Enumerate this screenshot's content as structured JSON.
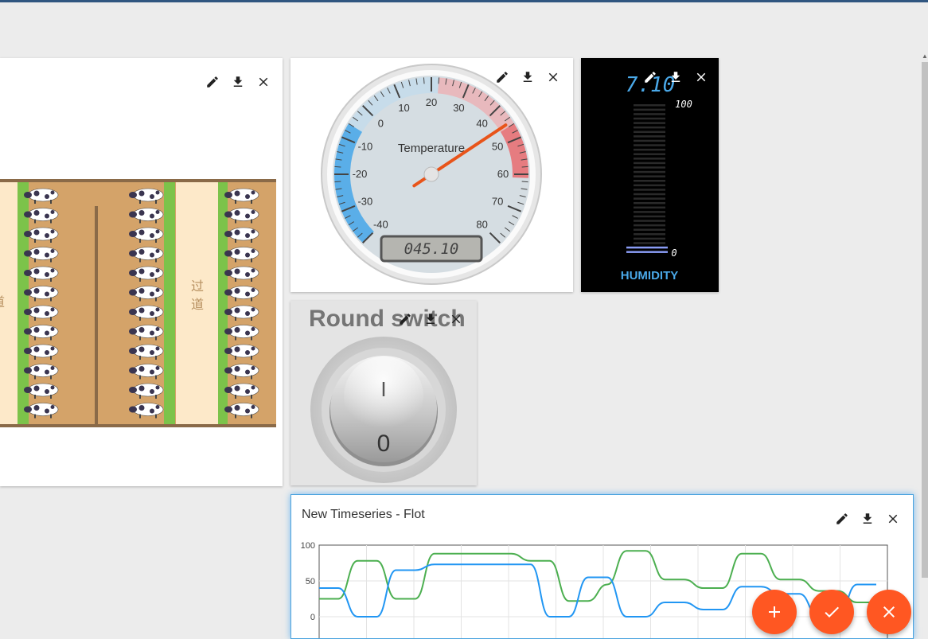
{
  "colors": {
    "accent": "#ff5722",
    "topbar": "#305680",
    "series1": "#4caf50",
    "series2": "#2196f3",
    "humidity_text": "#4aa9e9"
  },
  "farm": {
    "aisle_label_right": "过道",
    "aisle_label_left": "道"
  },
  "gauge": {
    "title": "Temperature",
    "ticks": [
      "-40",
      "-30",
      "-20",
      "-10",
      "0",
      "10",
      "20",
      "30",
      "40",
      "50",
      "60",
      "70",
      "80"
    ],
    "value": 45.1,
    "display": "045.10"
  },
  "humidity": {
    "value_text": "7.10",
    "max_label": "100",
    "min_label": "0",
    "label": "HUMIDITY",
    "level": 0.071
  },
  "round_switch": {
    "title": "Round switch",
    "on_label": "I",
    "off_label": "0"
  },
  "timeseries": {
    "title": "New Timeseries - Flot"
  },
  "chart_data": {
    "type": "line",
    "yticks": [
      "100",
      "50",
      "0"
    ],
    "ylim": [
      0,
      100
    ],
    "grid": true,
    "series": [
      {
        "values": [
          25,
          25,
          78,
          78,
          25,
          25,
          88,
          88,
          88,
          88,
          88,
          78,
          78,
          22,
          22,
          45,
          92,
          92,
          52,
          52,
          40,
          40,
          88,
          88,
          52,
          52,
          36,
          36,
          20,
          20
        ]
      },
      {
        "values": [
          40,
          40,
          0,
          0,
          65,
          65,
          73,
          73,
          73,
          73,
          73,
          73,
          0,
          0,
          55,
          55,
          0,
          0,
          20,
          20,
          10,
          10,
          42,
          42,
          32,
          32,
          0,
          0,
          45,
          45
        ]
      }
    ]
  },
  "icons": {
    "edit": "pencil-icon",
    "download": "download-icon",
    "close": "close-icon",
    "add": "plus-icon",
    "apply": "check-icon",
    "cancel": "close-icon"
  }
}
